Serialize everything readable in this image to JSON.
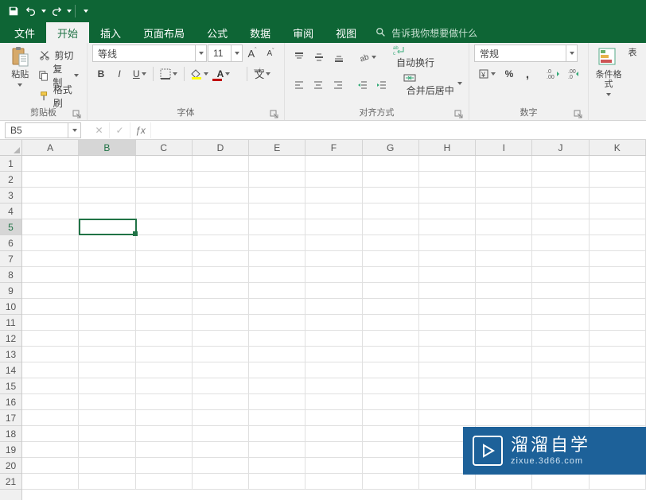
{
  "qat": {
    "save": "保存",
    "undo": "撤销",
    "redo": "重做"
  },
  "tabs": {
    "file": "文件",
    "home": "开始",
    "insert": "插入",
    "layout": "页面布局",
    "formulas": "公式",
    "data": "数据",
    "review": "审阅",
    "view": "视图",
    "tellme": "告诉我你想要做什么"
  },
  "clipboard": {
    "group_label": "剪贴板",
    "paste": "粘贴",
    "cut": "剪切",
    "copy": "复制",
    "format_painter": "格式刷"
  },
  "font": {
    "group_label": "字体",
    "name": "等线",
    "size": "11",
    "bold": "B",
    "italic": "I",
    "underline": "U",
    "ruby": "wén"
  },
  "alignment": {
    "group_label": "对齐方式",
    "wrap": "自动换行",
    "merge": "合并后居中"
  },
  "number": {
    "group_label": "数字",
    "format": "常规",
    "percent": "%",
    "comma": ","
  },
  "styles": {
    "cond_format": "条件格式",
    "table": "表"
  },
  "namebox": "B5",
  "formula": "",
  "columns": [
    "A",
    "B",
    "C",
    "D",
    "E",
    "F",
    "G",
    "H",
    "I",
    "J",
    "K"
  ],
  "rows": [
    "1",
    "2",
    "3",
    "4",
    "5",
    "6",
    "7",
    "8",
    "9",
    "10",
    "11",
    "12",
    "13",
    "14",
    "15",
    "16",
    "17",
    "18",
    "19",
    "20",
    "21"
  ],
  "active": {
    "col": "B",
    "row": "5",
    "colIndex": 1,
    "rowIndex": 4
  },
  "watermark": {
    "title": "溜溜自学",
    "sub": "zixue.3d66.com"
  }
}
